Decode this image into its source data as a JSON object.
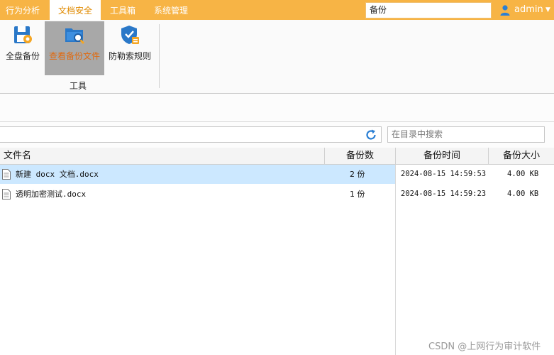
{
  "menu": {
    "tabs": [
      {
        "label": "行为分析"
      },
      {
        "label": "文档安全"
      },
      {
        "label": "工具箱"
      },
      {
        "label": "系统管理"
      }
    ],
    "search_value": "备份",
    "user": "admin"
  },
  "ribbon": {
    "tools": [
      {
        "label": "全盘备份",
        "icon": "disk-backup-icon"
      },
      {
        "label": "查看备份文件",
        "icon": "view-backup-icon"
      },
      {
        "label": "防勒索规则",
        "icon": "ransomware-shield-icon"
      }
    ],
    "group_label": "工具"
  },
  "pathbar": {
    "path_value": "",
    "search_placeholder": "在目录中搜索"
  },
  "table": {
    "headers": {
      "filename": "文件名",
      "backup_count": "备份数",
      "backup_time": "备份时间",
      "backup_size": "备份大小"
    },
    "rows": [
      {
        "name": "新建 docx 文档.docx",
        "count": "2 份",
        "time": "2024-08-15 14:59:53",
        "size": "4.00 KB",
        "selected": true
      },
      {
        "name": "透明加密测试.docx",
        "count": "1 份",
        "time": "2024-08-15 14:59:23",
        "size": "4.00 KB",
        "selected": false
      }
    ]
  },
  "watermark": "CSDN @上网行为审计软件",
  "colors": {
    "menubar": "#f7b445",
    "active_tab_text": "#e08a00",
    "selected_tool": "#a8a8a8",
    "selected_row": "#cce8ff"
  }
}
